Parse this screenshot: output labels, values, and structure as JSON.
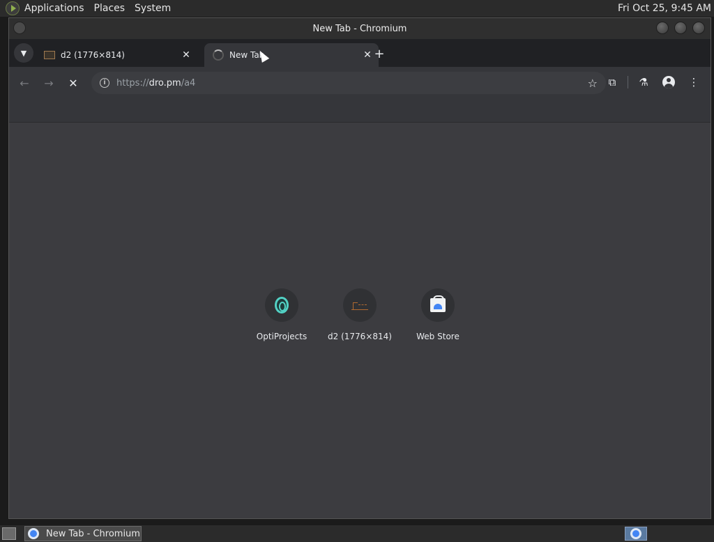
{
  "top_panel": {
    "menus": [
      "Applications",
      "Places",
      "System"
    ],
    "clock": "Fri Oct 25,  9:45 AM"
  },
  "window": {
    "title": "New Tab - Chromium"
  },
  "tabs": [
    {
      "title": "d2 (1776×814)",
      "favicon": "image-thumbnail-icon"
    },
    {
      "title": "New Tab",
      "favicon": "loading-spinner-icon"
    }
  ],
  "toolbar": {
    "url_scheme": "https://",
    "url_host": "dro.pm",
    "url_path": "/a4"
  },
  "shortcuts": [
    {
      "label": "OptiProjects",
      "icon": "optiprojects-icon"
    },
    {
      "label": "d2 (1776×814)",
      "icon": "d2-thumbnail-icon"
    },
    {
      "label": "Web Store",
      "icon": "web-store-icon"
    }
  ],
  "taskbar": {
    "task_label": "New Tab - Chromium"
  }
}
